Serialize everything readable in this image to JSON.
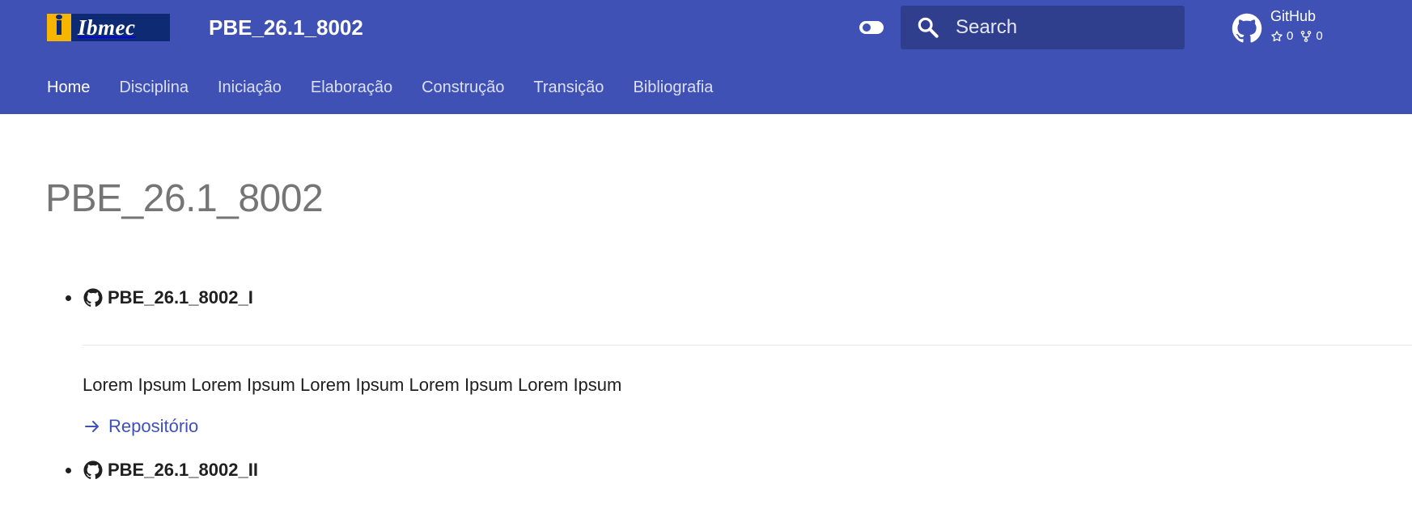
{
  "header": {
    "logo_text": "Ibmec",
    "site_title": "PBE_26.1_8002",
    "search": {
      "placeholder": "Search"
    },
    "repository": {
      "name": "GitHub",
      "stars": "0",
      "forks": "0"
    }
  },
  "navigation": {
    "tabs": [
      {
        "label": "Home",
        "active": true
      },
      {
        "label": "Disciplina",
        "active": false
      },
      {
        "label": "Iniciação",
        "active": false
      },
      {
        "label": "Elaboração",
        "active": false
      },
      {
        "label": "Construção",
        "active": false
      },
      {
        "label": "Transição",
        "active": false
      },
      {
        "label": "Bibliografia",
        "active": false
      }
    ]
  },
  "content": {
    "title": "PBE_26.1_8002",
    "projects": [
      {
        "name": "PBE_26.1_8002_I",
        "description": "Lorem Ipsum Lorem Ipsum Lorem Ipsum Lorem Ipsum Lorem Ipsum",
        "link_label": "Repositório"
      },
      {
        "name": "PBE_26.1_8002_II"
      }
    ]
  },
  "icons": {
    "theme": "toggle-icon",
    "search": "search-icon",
    "repository": "github-icon",
    "stars": "star-icon",
    "forks": "fork-icon",
    "repository_link": "arrow-right-icon"
  },
  "colors": {
    "primary": "#3f51b5",
    "search_background": "#303f8d",
    "logo_blue": "#0d2a73",
    "logo_yellow": "#f7b500",
    "text": "#1f1f1f",
    "muted_title": "#757575",
    "divider": "#e6e6e6"
  }
}
